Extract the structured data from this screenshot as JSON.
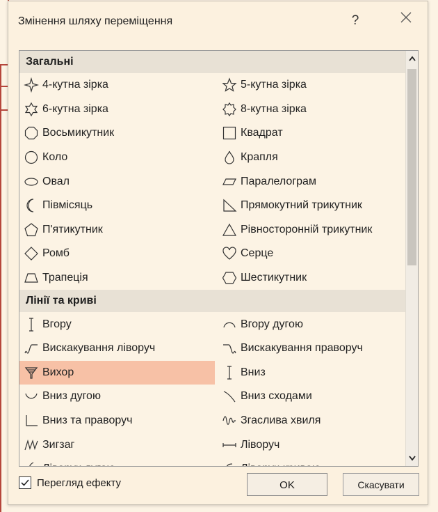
{
  "dialog": {
    "title": "Змінення шляху переміщення",
    "help": "?",
    "close_icon": "close-icon"
  },
  "groups": [
    {
      "header": "Загальні",
      "rows": [
        [
          {
            "label": "4-кутна зірка",
            "icon": "star4-icon"
          },
          {
            "label": "5-кутна зірка",
            "icon": "star5-icon"
          }
        ],
        [
          {
            "label": "6-кутна зірка",
            "icon": "star6-icon"
          },
          {
            "label": "8-кутна зірка",
            "icon": "star8-icon"
          }
        ],
        [
          {
            "label": "Восьмикутник",
            "icon": "octagon-icon"
          },
          {
            "label": "Квадрат",
            "icon": "square-icon"
          }
        ],
        [
          {
            "label": "Коло",
            "icon": "circle-icon"
          },
          {
            "label": "Крапля",
            "icon": "teardrop-icon"
          }
        ],
        [
          {
            "label": "Овал",
            "icon": "oval-icon"
          },
          {
            "label": "Паралелограм",
            "icon": "parallelogram-icon"
          }
        ],
        [
          {
            "label": "Півмісяць",
            "icon": "crescent-icon"
          },
          {
            "label": "Прямокутний трикутник",
            "icon": "right-triangle-icon"
          }
        ],
        [
          {
            "label": "П'ятикутник",
            "icon": "pentagon-icon"
          },
          {
            "label": "Рівносторонній трикутник",
            "icon": "equilateral-triangle-icon"
          }
        ],
        [
          {
            "label": "Ромб",
            "icon": "diamond-icon"
          },
          {
            "label": "Серце",
            "icon": "heart-icon"
          }
        ],
        [
          {
            "label": "Трапеція",
            "icon": "trapezoid-icon"
          },
          {
            "label": "Шестикутник",
            "icon": "hexagon-icon"
          }
        ]
      ]
    },
    {
      "header": "Лінії та криві",
      "rows": [
        [
          {
            "label": "Вгору",
            "icon": "line-up-icon"
          },
          {
            "label": "Вгору дугою",
            "icon": "arc-up-icon"
          }
        ],
        [
          {
            "label": "Вискакування ліворуч",
            "icon": "bounce-left-icon"
          },
          {
            "label": "Вискакування праворуч",
            "icon": "bounce-right-icon"
          }
        ],
        [
          {
            "label": "Вихор",
            "icon": "funnel-icon",
            "selected": true
          },
          {
            "label": "Вниз",
            "icon": "line-down-icon"
          }
        ],
        [
          {
            "label": "Вниз дугою",
            "icon": "arc-down-icon"
          },
          {
            "label": "Вниз сходами",
            "icon": "stairs-down-icon"
          }
        ],
        [
          {
            "label": "Вниз та праворуч",
            "icon": "down-right-icon"
          },
          {
            "label": "Згаслива хвиля",
            "icon": "decaying-wave-icon"
          }
        ],
        [
          {
            "label": "Зигзаг",
            "icon": "zigzag-icon"
          },
          {
            "label": "Ліворуч",
            "icon": "line-left-icon"
          }
        ],
        [
          {
            "label": "Ліворуч дугою",
            "icon": "arc-left-icon"
          },
          {
            "label": "Ліворуч кривою",
            "icon": "curve-left-icon"
          }
        ]
      ]
    }
  ],
  "preview": {
    "label": "Перегляд ефекту",
    "checked": true
  },
  "buttons": {
    "ok": "OK",
    "cancel": "Скасувати"
  },
  "colors": {
    "selected": "#f7c1a6",
    "group_header": "#e8e1d5",
    "background": "#fcf1df"
  }
}
